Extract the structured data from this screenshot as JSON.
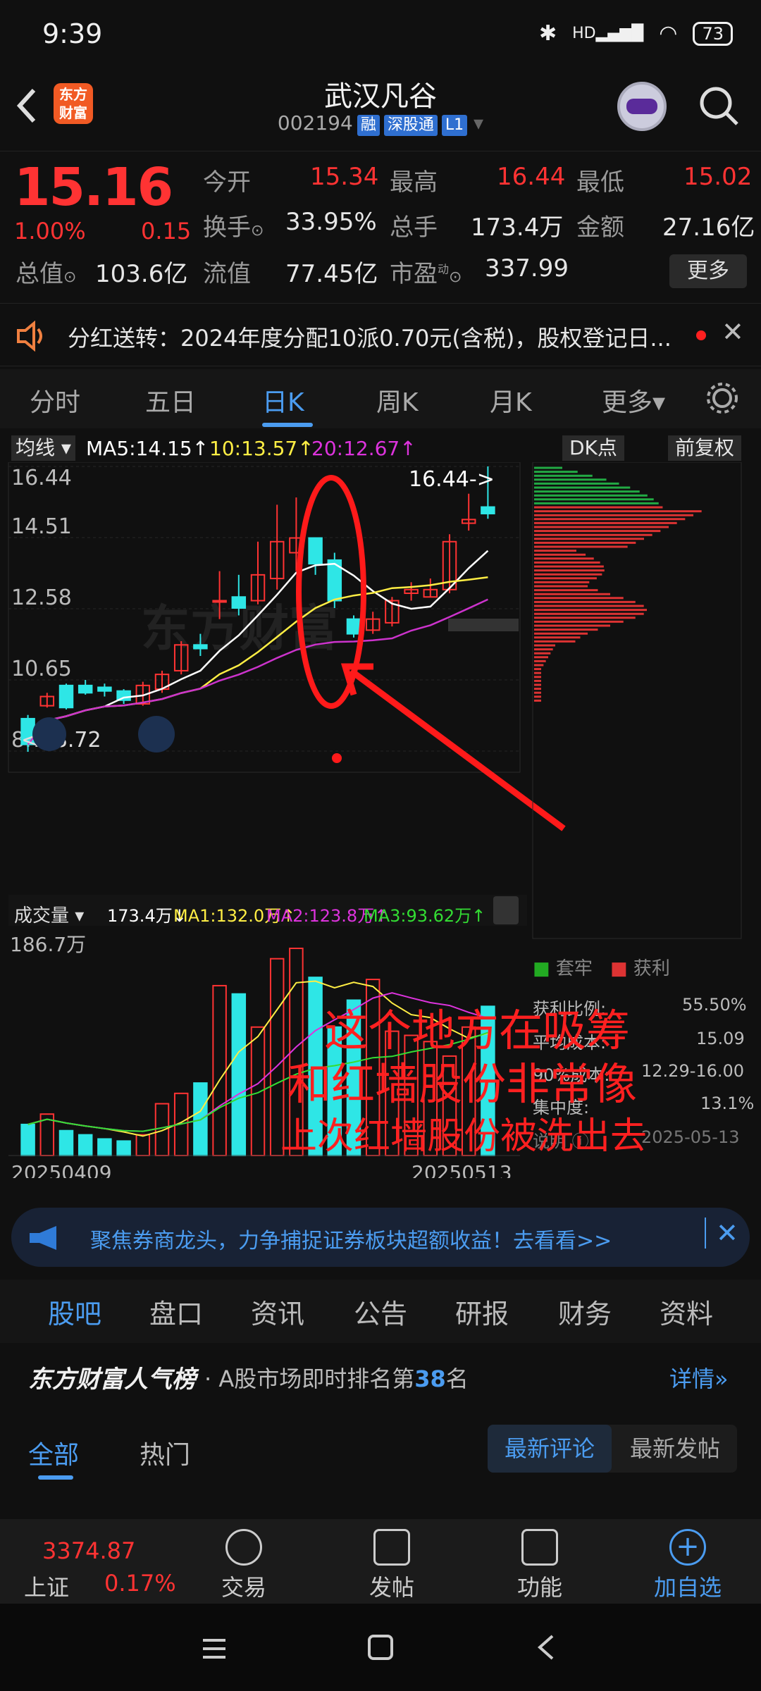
{
  "status_bar": {
    "time": "9:39",
    "battery": "73",
    "signal": "HD"
  },
  "header": {
    "title": "武汉凡谷",
    "code": "002194",
    "tag1": "融",
    "tag2": "深股通",
    "tag3": "L1",
    "logo_text": "东方财富"
  },
  "quote": {
    "price": "15.16",
    "change_pct": "1.00%",
    "change_amt": "0.15",
    "open_label": "今开",
    "open": "15.34",
    "high_label": "最高",
    "high": "16.44",
    "low_label": "最低",
    "low": "15.02",
    "turnover_label": "换手",
    "turnover": "33.95%",
    "volume_label": "总手",
    "volume": "173.4万",
    "amount_label": "金额",
    "amount": "27.16亿",
    "mktcap_label": "总值",
    "mktcap": "103.6亿",
    "float_label": "流值",
    "float": "77.45亿",
    "pe_label": "市盈",
    "pe_sup": "动",
    "pe": "337.99",
    "more": "更多"
  },
  "notice": {
    "text": "分红送转：2024年度分配10派0.70元(含税)，股权登记日..."
  },
  "chart_tabs": [
    "分时",
    "五日",
    "日K",
    "周K",
    "月K",
    "更多▾"
  ],
  "chart_header": {
    "ma_selector": "均线",
    "ma5": "MA5:14.15",
    "ma10": "10:13.57",
    "ma20": "20:12.67",
    "dk": "DK点",
    "adjust": "前复权"
  },
  "chart_data": {
    "type": "candlestick",
    "y_ticks": [
      "16.44",
      "14.51",
      "12.58",
      "10.65",
      "8.72"
    ],
    "ylim": [
      8.72,
      16.44
    ],
    "max_label": "16.44->",
    "min_label": "<--8.72",
    "candles": [
      {
        "o": 9.6,
        "c": 8.9,
        "h": 9.7,
        "l": 8.7
      },
      {
        "o": 9.95,
        "c": 10.2,
        "h": 10.3,
        "l": 9.9
      },
      {
        "o": 10.5,
        "c": 9.9,
        "h": 10.55,
        "l": 9.85
      },
      {
        "o": 10.5,
        "c": 10.3,
        "h": 10.65,
        "l": 10.25
      },
      {
        "o": 10.45,
        "c": 10.35,
        "h": 10.55,
        "l": 10.2
      },
      {
        "o": 10.35,
        "c": 10.1,
        "h": 10.4,
        "l": 10.0
      },
      {
        "o": 10.0,
        "c": 10.5,
        "h": 10.6,
        "l": 9.95
      },
      {
        "o": 10.4,
        "c": 10.8,
        "h": 10.9,
        "l": 10.3
      },
      {
        "o": 10.9,
        "c": 11.6,
        "h": 11.7,
        "l": 10.8
      },
      {
        "o": 11.6,
        "c": 11.5,
        "h": 11.9,
        "l": 11.3
      },
      {
        "o": 12.8,
        "c": 12.8,
        "h": 13.6,
        "l": 12.3
      },
      {
        "o": 12.9,
        "c": 12.6,
        "h": 13.5,
        "l": 12.4
      },
      {
        "o": 12.8,
        "c": 13.5,
        "h": 14.4,
        "l": 12.7
      },
      {
        "o": 13.4,
        "c": 14.4,
        "h": 15.4,
        "l": 13.1
      },
      {
        "o": 14.1,
        "c": 14.5,
        "h": 15.6,
        "l": 13.6
      },
      {
        "o": 14.5,
        "c": 13.8,
        "h": 14.5,
        "l": 13.5
      },
      {
        "o": 13.9,
        "c": 12.8,
        "h": 14.1,
        "l": 12.6
      },
      {
        "o": 12.3,
        "c": 11.9,
        "h": 12.4,
        "l": 11.8
      },
      {
        "o": 12.0,
        "c": 12.3,
        "h": 12.5,
        "l": 11.9
      },
      {
        "o": 12.2,
        "c": 12.8,
        "h": 12.9,
        "l": 12.1
      },
      {
        "o": 13.0,
        "c": 13.1,
        "h": 13.3,
        "l": 12.8
      },
      {
        "o": 12.9,
        "c": 13.1,
        "h": 13.4,
        "l": 12.9
      },
      {
        "o": 13.1,
        "c": 14.4,
        "h": 14.6,
        "l": 13.0
      },
      {
        "o": 14.9,
        "c": 15.0,
        "h": 15.7,
        "l": 14.7
      },
      {
        "o": 15.34,
        "c": 15.16,
        "h": 16.44,
        "l": 15.02
      }
    ],
    "ma_lines": [
      {
        "name": "MA5",
        "color": "#ffffff"
      },
      {
        "name": "MA10",
        "color": "#ffee44"
      },
      {
        "name": "MA20",
        "color": "#cc33cc"
      }
    ],
    "volume": {
      "label": "成交量",
      "value": "173.4万",
      "ma1": "MA1:132.0万",
      "ma2": "MA2:123.8万",
      "ma3": "MA3:93.62万",
      "max": "186.7万",
      "bars": [
        0.15,
        0.2,
        0.12,
        0.1,
        0.08,
        0.07,
        0.1,
        0.25,
        0.3,
        0.35,
        0.82,
        0.78,
        0.62,
        0.95,
        1.0,
        0.86,
        0.62,
        0.75,
        0.85,
        0.6,
        0.58,
        0.55,
        0.48,
        0.62,
        0.72
      ],
      "start_date": "20250409",
      "end_date": "20250513"
    }
  },
  "chip": {
    "legend_a": "套牢",
    "legend_b": "获利",
    "profit_label": "获利比例:",
    "profit": "55.50%",
    "avg_label": "平均成本:",
    "avg": "15.09",
    "cost90_label": "90%成本:",
    "cost90": "12.29-16.00",
    "conc_label": "集中度:",
    "conc": "13.1%",
    "note_label": "说明",
    "date": "2025-05-13"
  },
  "annotation": {
    "line1": "这个地方在吸筹",
    "line2": "和红墙股份非常像",
    "line3": "上次红墙股份被洗出去"
  },
  "promo": {
    "text": "聚焦券商龙头，力争捕捉证券板块超额收益！去看看>>"
  },
  "bottom_tabs": [
    "股吧",
    "盘口",
    "资讯",
    "公告",
    "研报",
    "财务",
    "资料"
  ],
  "rank": {
    "brand": "东方财富人气榜",
    "text": "· A股市场即时排名第",
    "rank": "38",
    "suffix": "名",
    "detail": "详情"
  },
  "sub_tabs": {
    "all": "全部",
    "hot": "热门",
    "latest_comment": "最新评论",
    "latest_post": "最新发帖"
  },
  "bottom_nav": {
    "index_name": "上证",
    "index_value": "3374.87",
    "index_pct": "0.17%",
    "trade": "交易",
    "post": "发帖",
    "func": "功能",
    "watch": "加自选"
  }
}
